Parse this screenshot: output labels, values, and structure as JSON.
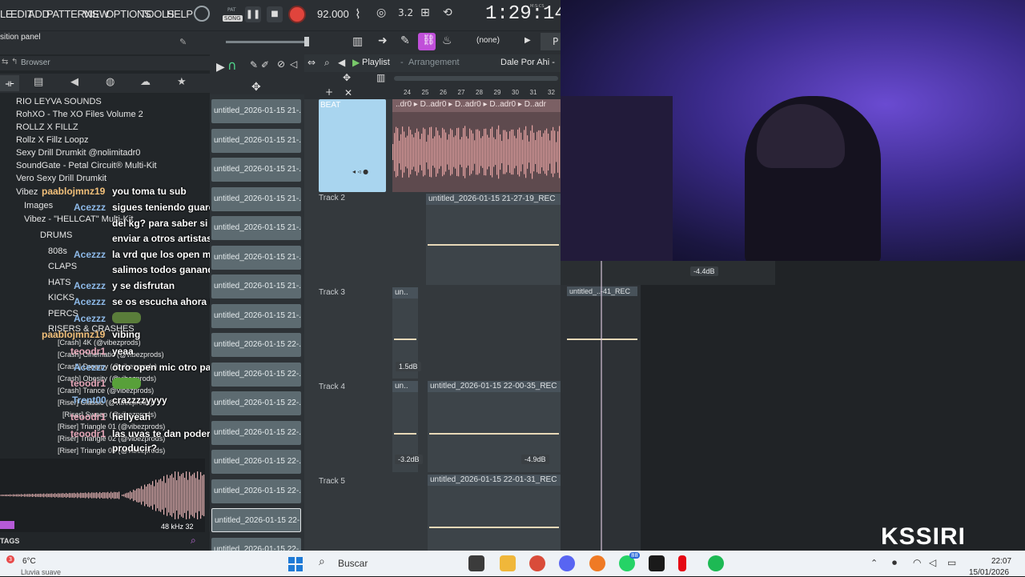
{
  "menu": {
    "file": "LE",
    "edit": "EDIT",
    "add": "ADD",
    "patterns": "PATTERNS",
    "view": "VIEW",
    "options": "OPTIONS",
    "tools": "TOOLS",
    "help": "HELP"
  },
  "transport": {
    "pat_label": "PAT",
    "song_label": "SONG",
    "tempo": "92.000",
    "time": "1:29:14",
    "time_unit": "M:S:CS",
    "snap": "(none)"
  },
  "panel": {
    "position_label": "sition panel",
    "browser_title": "Browser",
    "tags_label": "TAGS",
    "sample_rate": "48 kHz 32"
  },
  "playlist": {
    "title": "Playlist",
    "subtitle": "Arrangement",
    "song_name": "Dale Por Ahi -",
    "ruler": [
      "24",
      "25",
      "26",
      "27",
      "28",
      "29",
      "30",
      "31",
      "32"
    ],
    "beat_segments": "..dr0 ▸ D..adr0 ▸ D..adr0 ▸ D..adr0 ▸ D..adr",
    "tracks": [
      {
        "name": "BEAT"
      },
      {
        "name": "Track 2",
        "clip": "untitled_2026-01-15 21-27-19_REC"
      },
      {
        "name": "Track 3",
        "clip_a": "un..",
        "clip_b": "untitled_..-41_REC",
        "db": "1.5dB"
      },
      {
        "name": "Track 4",
        "clip_a": "un..",
        "clip_b": "untitled_2026-01-15 22-00-35_REC",
        "db_a": "-3.2dB",
        "db_b": "-4.9dB"
      },
      {
        "name": "Track 5",
        "clip": "untitled_2026-01-15 22-01-31_REC"
      }
    ]
  },
  "mixer": {
    "db": "-4.4dB"
  },
  "browser_tree": [
    "RIO LEYVA SOUNDS",
    "RohXO - The XO Files Volume 2",
    "ROLLZ X FILLZ",
    "Rollz X Fillz Loopz",
    "Sexy Drill Drumkit @nolimitadr0",
    "SoundGate - Petal Circuit® Multi-Kit",
    "Vero Sexy Drill Drumkit",
    "Vibez",
    "Images",
    "Vibez - \"HELLCAT\" Multi-Kit",
    "DRUMS",
    "808s",
    "CLAPS",
    "HATS",
    "KICKS",
    "PERCS",
    "RISERS & CRASHES",
    "[Crash] 4K (@vibezprods)",
    "[Crash] Cinematic (@vibezprods)",
    "[Crash] Dreamy (@vibezprods)",
    "[Crash] Obesity (@vibezprods)",
    "[Crash] Trance (@vibezprods)",
    "[Riser] Classic (@vibezprods)",
    "[Riser] Sweep (@vibezprods)",
    "[Riser] Triangle 01 (@vibezprods)",
    "[Riser] Triangle 02 (@vibezprods)",
    "[Riser] Triangle 03 (@vibezprods)"
  ],
  "patterns": [
    "untitled_2026-01-15 21-...",
    "untitled_2026-01-15 21-...",
    "untitled_2026-01-15 21-...",
    "untitled_2026-01-15 21-...",
    "untitled_2026-01-15 21-...",
    "untitled_2026-01-15 21-...",
    "untitled_2026-01-15 21-...",
    "untitled_2026-01-15 21-...",
    "untitled_2026-01-15 22-...",
    "untitled_2026-01-15 22-...",
    "untitled_2026-01-15 22-...",
    "untitled_2026-01-15 22-...",
    "untitled_2026-01-15 22-...",
    "untitled_2026-01-15 22-...",
    "untitled_2026-01-15 22-...",
    "untitled_2026-01-15 22-..."
  ],
  "chat": [
    {
      "user": "paablojmnz19",
      "msg": "you toma tu sub"
    },
    {
      "user": "Acezzz",
      "msg": "sigues teniendo guardado el drill"
    },
    {
      "user": "",
      "msg": "del kg? para saber si lo puedo"
    },
    {
      "user": "",
      "msg": "enviar a otros artistas"
    },
    {
      "user": "Acezzz",
      "msg": "la vrd que los open mic son la polla"
    },
    {
      "user": "",
      "msg": "salimos todos ganando"
    },
    {
      "user": "Acezzz",
      "msg": "y se disfrutan"
    },
    {
      "user": "Acezzz",
      "msg": "se os escucha ahora underwater"
    },
    {
      "user": "Acezzz",
      "msg": ""
    },
    {
      "user": "paablojmnz19",
      "msg": "vibing"
    },
    {
      "user": "teoodr1",
      "msg": "yeaa"
    },
    {
      "user": "Acezzz",
      "msg": "otro open mic otro palo"
    },
    {
      "user": "teoodr1",
      "msg": ""
    },
    {
      "user": "Trent00",
      "msg": "crazzzzyyyy"
    },
    {
      "user": "teoodr1",
      "msg": "hellyeah"
    },
    {
      "user": "teoodr1",
      "msg": "las uvas te dan poderes pa"
    },
    {
      "user": "",
      "msg": "producir?"
    }
  ],
  "watermark": "KSSIRI",
  "taskbar": {
    "temp": "6°C",
    "weather": "Lluvia suave",
    "search": "Buscar",
    "badge_count": "3",
    "whatsapp_badge": "88",
    "time": "22:07",
    "date": "15/01/2026"
  }
}
